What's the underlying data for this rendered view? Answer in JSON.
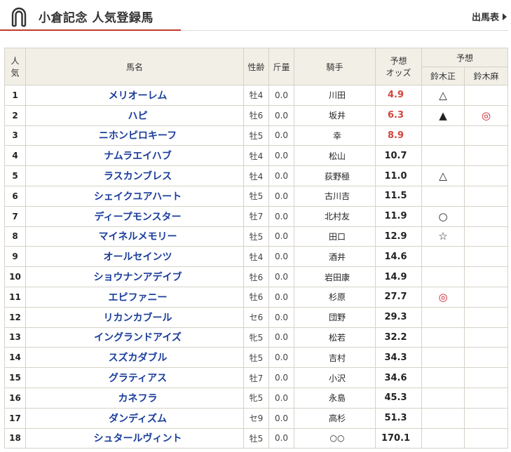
{
  "header": {
    "title": "小倉記念 人気登録馬",
    "entry_link": "出馬表"
  },
  "table": {
    "col_rank_line1": "人",
    "col_rank_line2": "気",
    "col_name": "馬名",
    "col_sexage": "性齢",
    "col_weight": "斤量",
    "col_jockey": "騎手",
    "col_odds_line1": "予想",
    "col_odds_line2": "オッズ",
    "col_pred_group": "予想",
    "col_pred_a": "鈴木正",
    "col_pred_b": "鈴木麻",
    "rows": [
      {
        "rank": "1",
        "name": "メリオーレム",
        "sexage": "牡4",
        "weight": "0.0",
        "jockey": "川田",
        "odds": "4.9",
        "hot": true,
        "mark_a": "△",
        "mark_b": ""
      },
      {
        "rank": "2",
        "name": "ハピ",
        "sexage": "牡6",
        "weight": "0.0",
        "jockey": "坂井",
        "odds": "6.3",
        "hot": true,
        "mark_a": "▲",
        "mark_b": "◎"
      },
      {
        "rank": "3",
        "name": "ニホンピロキーフ",
        "sexage": "牡5",
        "weight": "0.0",
        "jockey": "幸",
        "odds": "8.9",
        "hot": true,
        "mark_a": "",
        "mark_b": ""
      },
      {
        "rank": "4",
        "name": "ナムラエイハブ",
        "sexage": "牡4",
        "weight": "0.0",
        "jockey": "松山",
        "odds": "10.7",
        "hot": false,
        "mark_a": "",
        "mark_b": ""
      },
      {
        "rank": "5",
        "name": "ラスカンブレス",
        "sexage": "牡4",
        "weight": "0.0",
        "jockey": "荻野極",
        "odds": "11.0",
        "hot": false,
        "mark_a": "△",
        "mark_b": ""
      },
      {
        "rank": "6",
        "name": "シェイクユアハート",
        "sexage": "牡5",
        "weight": "0.0",
        "jockey": "古川吉",
        "odds": "11.5",
        "hot": false,
        "mark_a": "",
        "mark_b": ""
      },
      {
        "rank": "7",
        "name": "ディープモンスター",
        "sexage": "牡7",
        "weight": "0.0",
        "jockey": "北村友",
        "odds": "11.9",
        "hot": false,
        "mark_a": "○",
        "mark_b": ""
      },
      {
        "rank": "8",
        "name": "マイネルメモリー",
        "sexage": "牡5",
        "weight": "0.0",
        "jockey": "田口",
        "odds": "12.9",
        "hot": false,
        "mark_a": "☆",
        "mark_b": ""
      },
      {
        "rank": "9",
        "name": "オールセインツ",
        "sexage": "牡4",
        "weight": "0.0",
        "jockey": "酒井",
        "odds": "14.6",
        "hot": false,
        "mark_a": "",
        "mark_b": ""
      },
      {
        "rank": "10",
        "name": "ショウナンアデイブ",
        "sexage": "牡6",
        "weight": "0.0",
        "jockey": "岩田康",
        "odds": "14.9",
        "hot": false,
        "mark_a": "",
        "mark_b": ""
      },
      {
        "rank": "11",
        "name": "エピファニー",
        "sexage": "牡6",
        "weight": "0.0",
        "jockey": "杉原",
        "odds": "27.7",
        "hot": false,
        "mark_a": "◎",
        "mark_b": ""
      },
      {
        "rank": "12",
        "name": "リカンカブール",
        "sexage": "セ6",
        "weight": "0.0",
        "jockey": "団野",
        "odds": "29.3",
        "hot": false,
        "mark_a": "",
        "mark_b": ""
      },
      {
        "rank": "13",
        "name": "イングランドアイズ",
        "sexage": "牝5",
        "weight": "0.0",
        "jockey": "松若",
        "odds": "32.2",
        "hot": false,
        "mark_a": "",
        "mark_b": ""
      },
      {
        "rank": "14",
        "name": "スズカダブル",
        "sexage": "牡5",
        "weight": "0.0",
        "jockey": "吉村",
        "odds": "34.3",
        "hot": false,
        "mark_a": "",
        "mark_b": ""
      },
      {
        "rank": "15",
        "name": "グラティアス",
        "sexage": "牡7",
        "weight": "0.0",
        "jockey": "小沢",
        "odds": "34.6",
        "hot": false,
        "mark_a": "",
        "mark_b": ""
      },
      {
        "rank": "16",
        "name": "カネフラ",
        "sexage": "牝5",
        "weight": "0.0",
        "jockey": "永島",
        "odds": "45.3",
        "hot": false,
        "mark_a": "",
        "mark_b": ""
      },
      {
        "rank": "17",
        "name": "ダンディズム",
        "sexage": "セ9",
        "weight": "0.0",
        "jockey": "高杉",
        "odds": "51.3",
        "hot": false,
        "mark_a": "",
        "mark_b": ""
      },
      {
        "rank": "18",
        "name": "シュタールヴィント",
        "sexage": "牡5",
        "weight": "0.0",
        "jockey": "○○",
        "odds": "170.1",
        "hot": false,
        "mark_a": "",
        "mark_b": ""
      }
    ]
  },
  "colors": {
    "accent": "#c0392b",
    "link": "#1a3d9b",
    "hot_odds": "#d1453b",
    "header_bg": "#f1efe6"
  }
}
